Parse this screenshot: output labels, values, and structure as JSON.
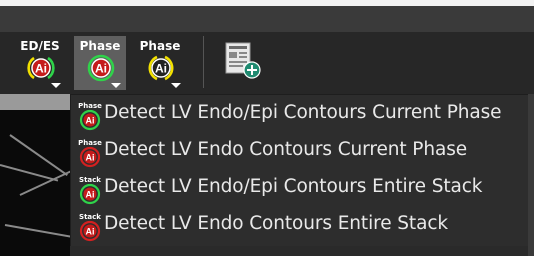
{
  "toolbar": {
    "buttons": [
      {
        "label": "ED/ES",
        "icon": "auto-ai-icon",
        "active": false
      },
      {
        "label": "Phase",
        "icon": "auto-ai-icon",
        "active": true
      },
      {
        "label": "Phase",
        "icon": "auto-ai-icon",
        "active": false
      }
    ],
    "report_icon": "report-add-icon"
  },
  "menu": {
    "items": [
      {
        "badge": "Phase",
        "label": "Detect LV Endo/Epi Contours Current Phase",
        "ring": "green"
      },
      {
        "badge": "Phase",
        "label": "Detect LV Endo Contours Current Phase",
        "ring": "red"
      },
      {
        "badge": "Stack",
        "label": "Detect LV Endo/Epi Contours Entire Stack",
        "ring": "green"
      },
      {
        "badge": "Stack",
        "label": "Detect LV Endo Contours Entire Stack",
        "ring": "red"
      }
    ]
  },
  "colors": {
    "green_ring": "#2fd34a",
    "red_ring": "#d42020",
    "yellow_ring": "#f2e000",
    "ai_badge_red": "#c41b1b",
    "menu_bg": "#2d2d2d"
  }
}
